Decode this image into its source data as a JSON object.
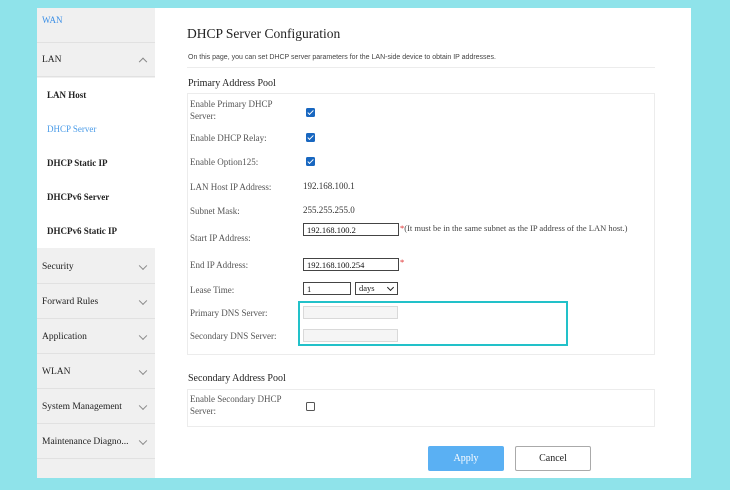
{
  "sidebar": {
    "items": [
      {
        "label": "WAN"
      },
      {
        "label": "LAN"
      },
      {
        "label": "Security"
      },
      {
        "label": "Forward Rules"
      },
      {
        "label": "Application"
      },
      {
        "label": "WLAN"
      },
      {
        "label": "System Management"
      },
      {
        "label": "Maintenance Diagno..."
      }
    ],
    "lan_sub": [
      {
        "label": "LAN Host"
      },
      {
        "label": "DHCP Server"
      },
      {
        "label": "DHCP Static IP"
      },
      {
        "label": "DHCPv6 Server"
      },
      {
        "label": "DHCPv6 Static IP"
      }
    ]
  },
  "page": {
    "title": "DHCP Server Configuration",
    "description": "On this page, you can set DHCP server parameters for the LAN-side device to obtain IP addresses."
  },
  "primary": {
    "title": "Primary Address Pool",
    "enable_dhcp_label": "Enable Primary DHCP Server:",
    "enable_relay_label": "Enable DHCP Relay:",
    "enable_option125_label": "Enable Option125:",
    "lan_host_ip_label": "LAN Host IP Address:",
    "lan_host_ip_value": "192.168.100.1",
    "subnet_mask_label": "Subnet Mask:",
    "subnet_mask_value": "255.255.255.0",
    "start_ip_label": "Start IP Address:",
    "start_ip_value": "192.168.100.2",
    "start_ip_note": "(It must be in the same subnet as the IP address of the LAN host.)",
    "end_ip_label": "End IP Address:",
    "end_ip_value": "192.168.100.254",
    "required_mark": "*",
    "lease_time_label": "Lease Time:",
    "lease_time_value": "1",
    "lease_unit": "days",
    "primary_dns_label": "Primary DNS Server:",
    "primary_dns_value": "",
    "secondary_dns_label": "Secondary DNS Server:",
    "secondary_dns_value": ""
  },
  "secondary": {
    "title": "Secondary Address Pool",
    "enable_dhcp_label": "Enable Secondary DHCP Server:"
  },
  "buttons": {
    "apply": "Apply",
    "cancel": "Cancel"
  },
  "colors": {
    "background": "#8fe3ea",
    "accent": "#3a8ee6",
    "highlight": "#22c1c9",
    "apply_button": "#5ab0f3"
  }
}
